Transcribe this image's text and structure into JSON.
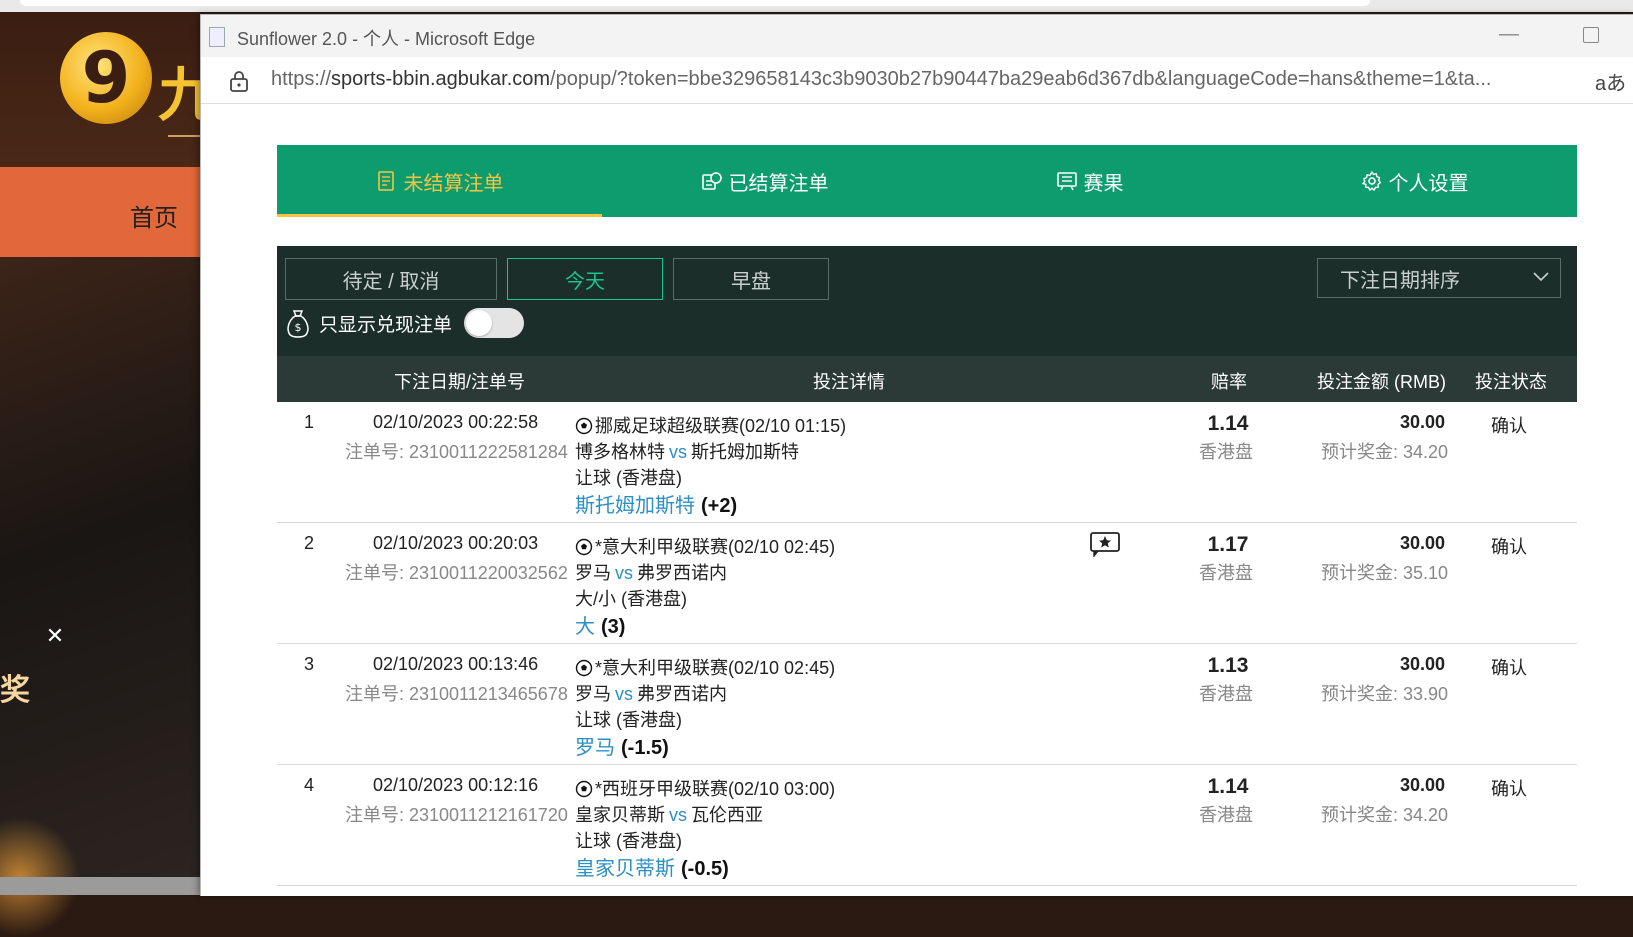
{
  "bg": {
    "logo_char": "九",
    "nav_home": "首页",
    "close_glyph": "✕",
    "badge_text": "奖"
  },
  "browser": {
    "title": "Sunflower 2.0 - 个人 - Microsoft Edge",
    "url_scheme": "https://",
    "url_host": "sports-bbin.agbukar.com",
    "url_rest": "/popup/?token=bbe329658143c3b9030b27b90447ba29eab6d367db&languageCode=hans&theme=1&ta...",
    "read_aloud": "aあ"
  },
  "tabs": [
    {
      "label": "未结算注单",
      "icon": "ticket-icon",
      "active": true
    },
    {
      "label": "已结算注单",
      "icon": "coins-icon",
      "active": false
    },
    {
      "label": "赛果",
      "icon": "scoreboard-icon",
      "active": false
    },
    {
      "label": "个人设置",
      "icon": "gear-icon",
      "active": false
    }
  ],
  "filters": {
    "pending": "待定 / 取消",
    "today": "今天",
    "early": "早盘",
    "sort": "下注日期排序",
    "cashout_only": "只显示兑现注单",
    "cashout_toggle_on": false
  },
  "table": {
    "headers": {
      "date_ticket": "下注日期/注单号",
      "details": "投注详情",
      "odds": "赔率",
      "stake": "投注金额 (RMB)",
      "status": "投注状态"
    },
    "rows": [
      {
        "idx": "1",
        "date": "02/10/2023 00:22:58",
        "ticket": "注单号: 2310011222581284",
        "league": "挪威足球超级联赛(02/10 01:15)",
        "home": "博多格林特",
        "vs": "vs",
        "away": "斯托姆加斯特",
        "market": "让球 (香港盘)",
        "selection": "斯托姆加斯特",
        "handicap": "(+2)",
        "odds": "1.14",
        "odds_type": "香港盘",
        "stake": "30.00",
        "payout": "预计奖金: 34.20",
        "status": "确认",
        "has_stream": false
      },
      {
        "idx": "2",
        "date": "02/10/2023 00:20:03",
        "ticket": "注单号: 2310011220032562",
        "league": "*意大利甲级联赛(02/10 02:45)",
        "home": "罗马",
        "vs": "vs",
        "away": "弗罗西诺内",
        "market": "大/小 (香港盘)",
        "selection": "大",
        "handicap": "(3)",
        "odds": "1.17",
        "odds_type": "香港盘",
        "stake": "30.00",
        "payout": "预计奖金: 35.10",
        "status": "确认",
        "has_stream": true
      },
      {
        "idx": "3",
        "date": "02/10/2023 00:13:46",
        "ticket": "注单号: 2310011213465678",
        "league": "*意大利甲级联赛(02/10 02:45)",
        "home": "罗马",
        "vs": "vs",
        "away": "弗罗西诺内",
        "market": "让球 (香港盘)",
        "selection": "罗马",
        "handicap": "(-1.5)",
        "odds": "1.13",
        "odds_type": "香港盘",
        "stake": "30.00",
        "payout": "预计奖金: 33.90",
        "status": "确认",
        "has_stream": false
      },
      {
        "idx": "4",
        "date": "02/10/2023 00:12:16",
        "ticket": "注单号: 2310011212161720",
        "league": "*西班牙甲级联赛(02/10 03:00)",
        "home": "皇家贝蒂斯",
        "vs": "vs",
        "away": "瓦伦西亚",
        "market": "让球 (香港盘)",
        "selection": "皇家贝蒂斯",
        "handicap": "(-0.5)",
        "odds": "1.14",
        "odds_type": "香港盘",
        "stake": "30.00",
        "payout": "预计奖金: 34.20",
        "status": "确认",
        "has_stream": false
      }
    ]
  },
  "colors": {
    "tab_bg": "#0c9c6e",
    "tab_active": "#f5c342",
    "panel_bg": "#1c2e2a",
    "header_bg": "#2b3a37",
    "accent_green": "#19c58b",
    "link_blue": "#2e8fc4"
  }
}
